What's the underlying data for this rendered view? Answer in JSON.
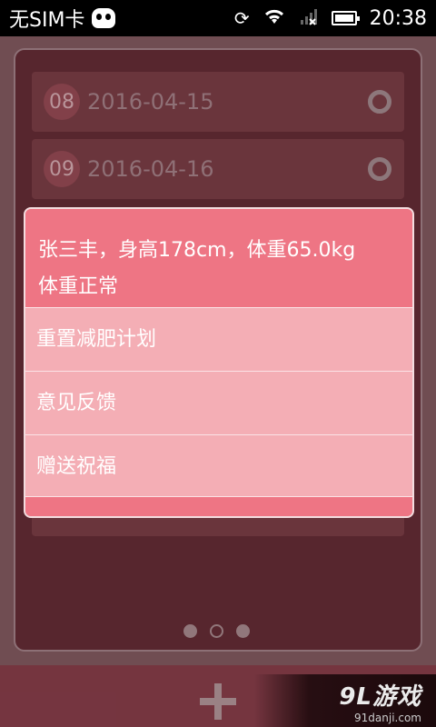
{
  "status_bar": {
    "carrier": "无SIM卡",
    "time": "20:38",
    "icons": [
      "sync-icon",
      "wifi-icon",
      "signal-icon",
      "battery-icon"
    ]
  },
  "records": [
    {
      "day": "08",
      "date": "2016-04-15"
    },
    {
      "day": "09",
      "date": "2016-04-16"
    }
  ],
  "dialog": {
    "title_line1": "张三丰，身高178cm，体重65.0kg",
    "title_line2": "体重正常",
    "items": [
      "重置减肥计划",
      "意见反馈",
      "赠送祝福"
    ]
  },
  "pager": {
    "count": 3,
    "active_index": 1
  },
  "watermark": {
    "logo": "9L游戏",
    "url": "91danji.com"
  },
  "colors": {
    "background": "#6f3a42",
    "dialog_header": "#ee7584",
    "dialog_body": "#f4aeb5"
  }
}
